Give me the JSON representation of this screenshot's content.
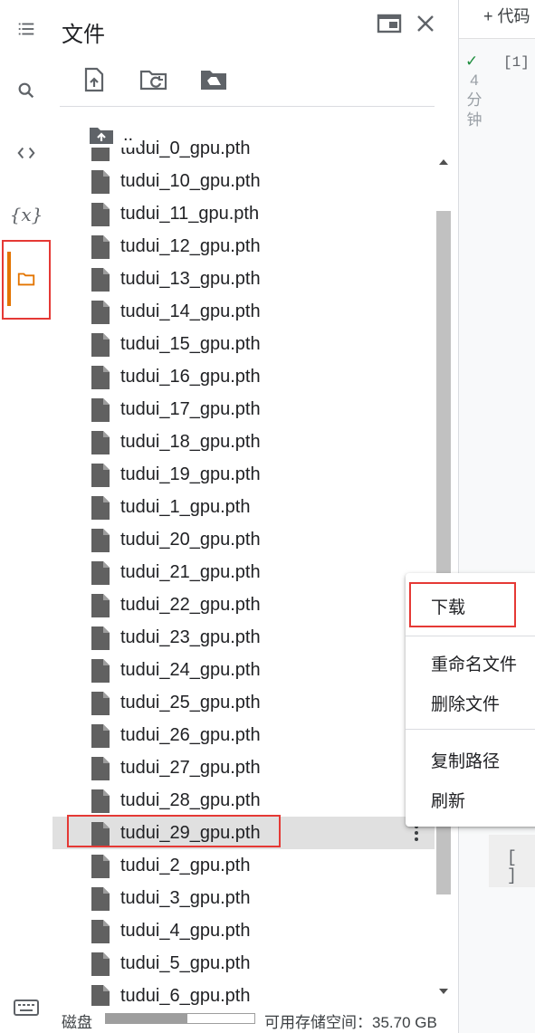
{
  "panel": {
    "title": "文件"
  },
  "parent_dir": {
    "label": ".."
  },
  "files": [
    "tudui_0_gpu.pth",
    "tudui_10_gpu.pth",
    "tudui_11_gpu.pth",
    "tudui_12_gpu.pth",
    "tudui_13_gpu.pth",
    "tudui_14_gpu.pth",
    "tudui_15_gpu.pth",
    "tudui_16_gpu.pth",
    "tudui_17_gpu.pth",
    "tudui_18_gpu.pth",
    "tudui_19_gpu.pth",
    "tudui_1_gpu.pth",
    "tudui_20_gpu.pth",
    "tudui_21_gpu.pth",
    "tudui_22_gpu.pth",
    "tudui_23_gpu.pth",
    "tudui_24_gpu.pth",
    "tudui_25_gpu.pth",
    "tudui_26_gpu.pth",
    "tudui_27_gpu.pth",
    "tudui_28_gpu.pth",
    "tudui_29_gpu.pth",
    "tudui_2_gpu.pth",
    "tudui_3_gpu.pth",
    "tudui_4_gpu.pth",
    "tudui_5_gpu.pth",
    "tudui_6_gpu.pth"
  ],
  "selected_file": "tudui_29_gpu.pth",
  "context_menu": {
    "download": "下载",
    "rename": "重命名文件",
    "delete": "删除文件",
    "copy_path": "复制路径",
    "refresh": "刷新"
  },
  "footer": {
    "disk_label": "磁盘",
    "disk_used_fraction": 0.55,
    "available": "可用存储空间：35.70 GB"
  },
  "notebook": {
    "add_code": "+ 代码",
    "exec_count": "[1]",
    "exec_time": [
      "4",
      "分",
      "钟"
    ],
    "empty_cell": "[ ]"
  },
  "colors": {
    "accent_orange": "#e37400",
    "highlight_red": "#e53935",
    "check_green": "#1e8e3e"
  },
  "icons": {
    "rail": [
      "table-of-contents-icon",
      "search-icon",
      "code-snippets-icon",
      "variables-icon",
      "folder-icon"
    ],
    "toolbar": [
      "upload-file-icon",
      "refresh-folder-icon",
      "mount-drive-icon"
    ],
    "header": [
      "open-in-tab-icon",
      "close-icon"
    ]
  }
}
